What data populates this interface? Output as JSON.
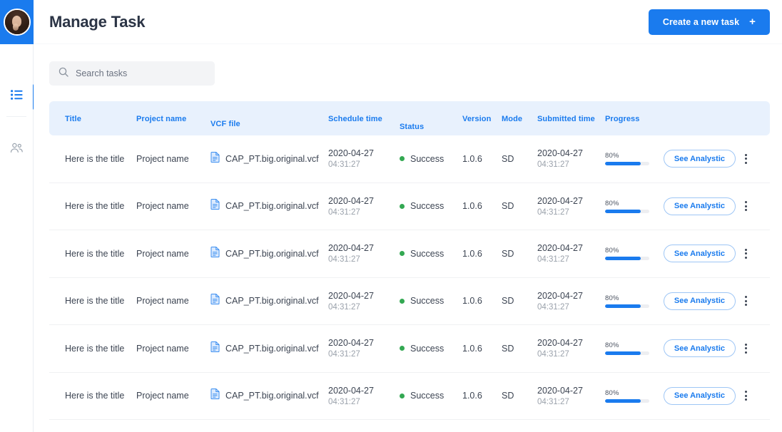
{
  "sidebar": {
    "avatar_name": "user-avatar",
    "items": [
      {
        "id": "tasks",
        "icon": "list-icon",
        "active": true
      },
      {
        "id": "users",
        "icon": "users-icon",
        "active": false
      }
    ]
  },
  "header": {
    "title": "Manage Task",
    "create_button": {
      "label": "Create a new task",
      "icon": "plus-icon"
    }
  },
  "search": {
    "placeholder": "Search tasks",
    "value": "",
    "icon": "search-icon"
  },
  "colors": {
    "accent": "#1a7bee",
    "header_bg": "#e8f1fd",
    "success": "#33a852",
    "progress_track": "#edeef1"
  },
  "table": {
    "columns": [
      {
        "key": "title",
        "label": "Title"
      },
      {
        "key": "project",
        "label": "Project name"
      },
      {
        "key": "vcf",
        "label": "VCF file"
      },
      {
        "key": "schedule",
        "label": "Schedule time"
      },
      {
        "key": "status",
        "label": "Status"
      },
      {
        "key": "version",
        "label": "Version"
      },
      {
        "key": "mode",
        "label": "Mode"
      },
      {
        "key": "submitted",
        "label": "Submitted time"
      },
      {
        "key": "progress",
        "label": "Progress"
      }
    ],
    "row_action_label": "See Analystic",
    "row_menu_icon": "kebab-menu-icon",
    "file_icon": "file-document-icon",
    "rows": [
      {
        "title": "Here is the title",
        "project": "Project name",
        "vcf": "CAP_PT.big.original.vcf",
        "schedule_date": "2020-04-27",
        "schedule_time": "04:31:27",
        "status": "Success",
        "version": "1.0.6",
        "mode": "SD",
        "submitted_date": "2020-04-27",
        "submitted_time": "04:31:27",
        "progress": "80%",
        "progress_value": 80
      },
      {
        "title": "Here is the title",
        "project": "Project name",
        "vcf": "CAP_PT.big.original.vcf",
        "schedule_date": "2020-04-27",
        "schedule_time": "04:31:27",
        "status": "Success",
        "version": "1.0.6",
        "mode": "SD",
        "submitted_date": "2020-04-27",
        "submitted_time": "04:31:27",
        "progress": "80%",
        "progress_value": 80
      },
      {
        "title": "Here is the title",
        "project": "Project name",
        "vcf": "CAP_PT.big.original.vcf",
        "schedule_date": "2020-04-27",
        "schedule_time": "04:31:27",
        "status": "Success",
        "version": "1.0.6",
        "mode": "SD",
        "submitted_date": "2020-04-27",
        "submitted_time": "04:31:27",
        "progress": "80%",
        "progress_value": 80
      },
      {
        "title": "Here is the title",
        "project": "Project name",
        "vcf": "CAP_PT.big.original.vcf",
        "schedule_date": "2020-04-27",
        "schedule_time": "04:31:27",
        "status": "Success",
        "version": "1.0.6",
        "mode": "SD",
        "submitted_date": "2020-04-27",
        "submitted_time": "04:31:27",
        "progress": "80%",
        "progress_value": 80
      },
      {
        "title": "Here is the title",
        "project": "Project name",
        "vcf": "CAP_PT.big.original.vcf",
        "schedule_date": "2020-04-27",
        "schedule_time": "04:31:27",
        "status": "Success",
        "version": "1.0.6",
        "mode": "SD",
        "submitted_date": "2020-04-27",
        "submitted_time": "04:31:27",
        "progress": "80%",
        "progress_value": 80
      },
      {
        "title": "Here is the title",
        "project": "Project name",
        "vcf": "CAP_PT.big.original.vcf",
        "schedule_date": "2020-04-27",
        "schedule_time": "04:31:27",
        "status": "Success",
        "version": "1.0.6",
        "mode": "SD",
        "submitted_date": "2020-04-27",
        "submitted_time": "04:31:27",
        "progress": "80%",
        "progress_value": 80
      }
    ]
  }
}
